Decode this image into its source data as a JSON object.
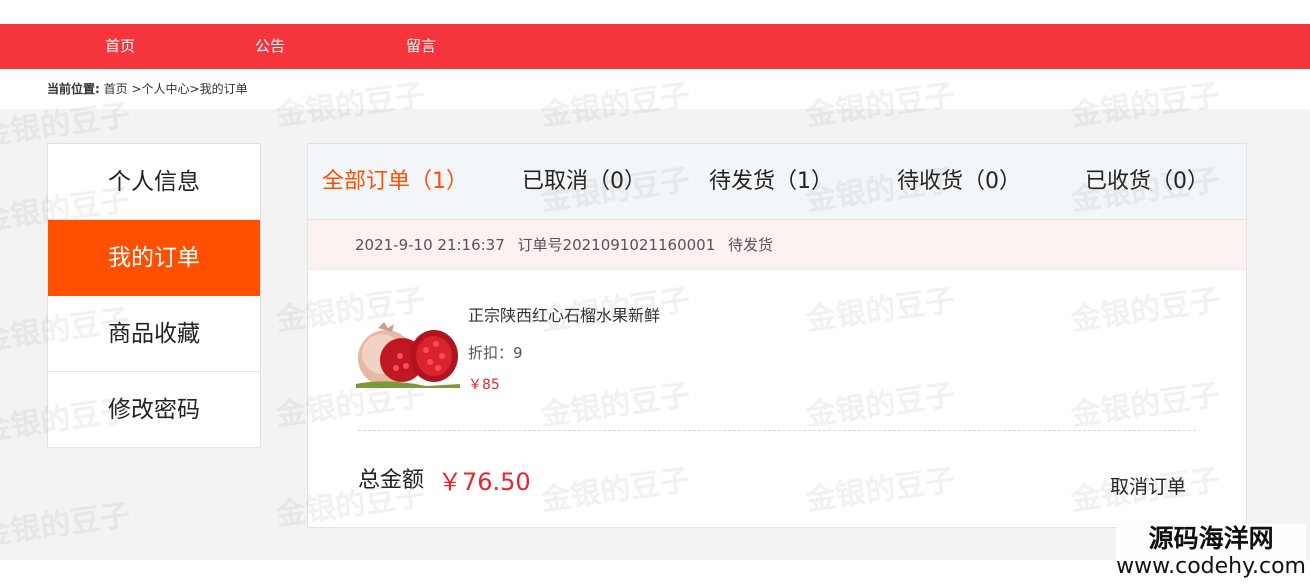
{
  "nav": {
    "items": [
      "首页",
      "公告",
      "留言"
    ],
    "color": "#f4363c"
  },
  "breadcrumb": {
    "label": "当前位置:",
    "home": "首页",
    "level1": ">个人中心",
    "level2": ">我的订单"
  },
  "sidebar": {
    "items": [
      "个人信息",
      "我的订单",
      "商品收藏",
      "修改密码"
    ],
    "active_index": 1,
    "active_color": "#ff4f00"
  },
  "tabs": {
    "items": [
      "全部订单（1）",
      "已取消（0）",
      "待发货（1）",
      "待收货（0）",
      "已收货（0）"
    ],
    "active_index": 0
  },
  "order": {
    "datetime": "2021-9-10 21:16:37",
    "number": "订单号2021091021160001",
    "status": "待发货",
    "product": {
      "name": "正宗陕西红心石榴水果新鲜",
      "discount": "折扣：9",
      "price": "￥85",
      "image": "pomegranate-image"
    },
    "total_label": "总金额",
    "total_value": "￥76.50",
    "cancel_label": "取消订单"
  },
  "watermark": "金银的豆子",
  "brand": {
    "line1": "源码海洋网",
    "line2": "www.codehy.com"
  }
}
